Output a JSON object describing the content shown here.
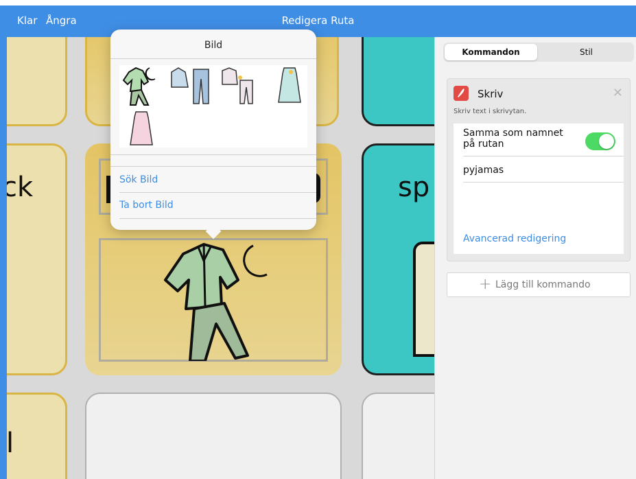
{
  "topbar": {
    "done": "Klar",
    "undo": "Ångra",
    "title": "Redigera Ruta"
  },
  "canvas": {
    "tiles": {
      "left_text": "ck",
      "right_text": "sp",
      "bottom_left_text": "l"
    }
  },
  "popover": {
    "title": "Bild",
    "images": [
      "pajamas-moon-icon",
      "shirt-pants-icon",
      "pajama-set-icon",
      "nightgown-blue-icon",
      "nightgown-pink-icon"
    ],
    "search_label": "Sök Bild",
    "remove_label": "Ta bort Bild"
  },
  "panel": {
    "tabs": [
      {
        "label": "Kommandon",
        "active": true
      },
      {
        "label": "Stil",
        "active": false
      }
    ],
    "command": {
      "icon": "feather-pen-icon",
      "title": "Skriv",
      "description": "Skriv text i skrivytan.",
      "toggle_label": "Samma som namnet på rutan",
      "toggle_on": true,
      "text_value": "pyjamas",
      "advanced_link": "Avancerad redigering"
    },
    "add_command_label": "Lägg till kommando"
  },
  "colors": {
    "accent": "#3f8ee6",
    "link": "#3b8de5",
    "toggle_on": "#4cd964",
    "tile_yellow": "#f7e3a0",
    "tile_teal": "#41d4d1",
    "command_icon": "#e24b43"
  }
}
